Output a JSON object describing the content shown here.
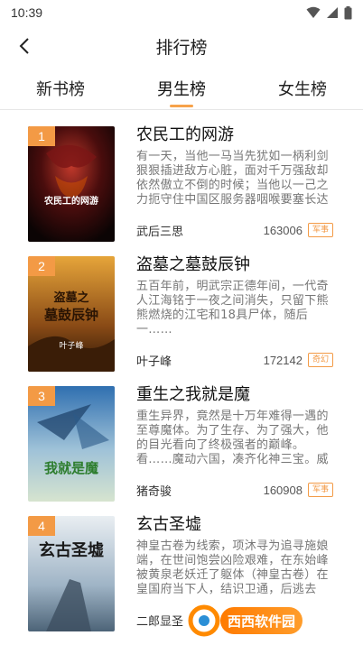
{
  "status": {
    "time": "10:39"
  },
  "header": {
    "title": "排行榜"
  },
  "tabs": [
    {
      "label": "新书榜",
      "active": false
    },
    {
      "label": "男生榜",
      "active": true
    },
    {
      "label": "女生榜",
      "active": false
    }
  ],
  "books": [
    {
      "rank": "1",
      "title": "农民工的网游",
      "desc": "有一天，当他一马当先犹如一柄利剑狠狠插进敌方心脏，面对千万强敌却依然傲立不倒的时候；当他以一己之力扼守住中国区服务器咽喉要塞长达",
      "author": "武后三思",
      "count": "163006",
      "tag": "军事",
      "cover_text": "农民工的网游"
    },
    {
      "rank": "2",
      "title": "盗墓之墓鼓辰钟",
      "desc": "五百年前，明武宗正德年间，一代奇人江海铭于一夜之间消失，只留下熊熊燃烧的江宅和18具尸体，随后一……",
      "author": "叶子峰",
      "count": "172142",
      "tag": "奇幻",
      "cover_text": "盗墓之墓鼓辰钟",
      "cover_author": "叶子峰"
    },
    {
      "rank": "3",
      "title": "重生之我就是魔",
      "desc": "重生异界，竟然是十万年难得一遇的至尊魔体。为了生存、为了强大，他的目光看向了终极强者的巅峰。看……魔动六国，凑齐化神三宝。威震海外",
      "author": "猪奇骏",
      "count": "160908",
      "tag": "军事",
      "cover_text": "我就是魔"
    },
    {
      "rank": "4",
      "title": "玄古圣墟",
      "desc": "神皇古卷为线索，项沐寻为追寻施娘端，在世间饱尝凶险艰难，在东始峰被黄泉老妖迁了躯体（神皇古卷）在皇国府当下人，结识卫通，后逃去",
      "author": "二郎显圣",
      "count": "",
      "tag": "",
      "cover_text": "玄古圣墟"
    }
  ],
  "watermark": {
    "text": "西西软件园"
  }
}
